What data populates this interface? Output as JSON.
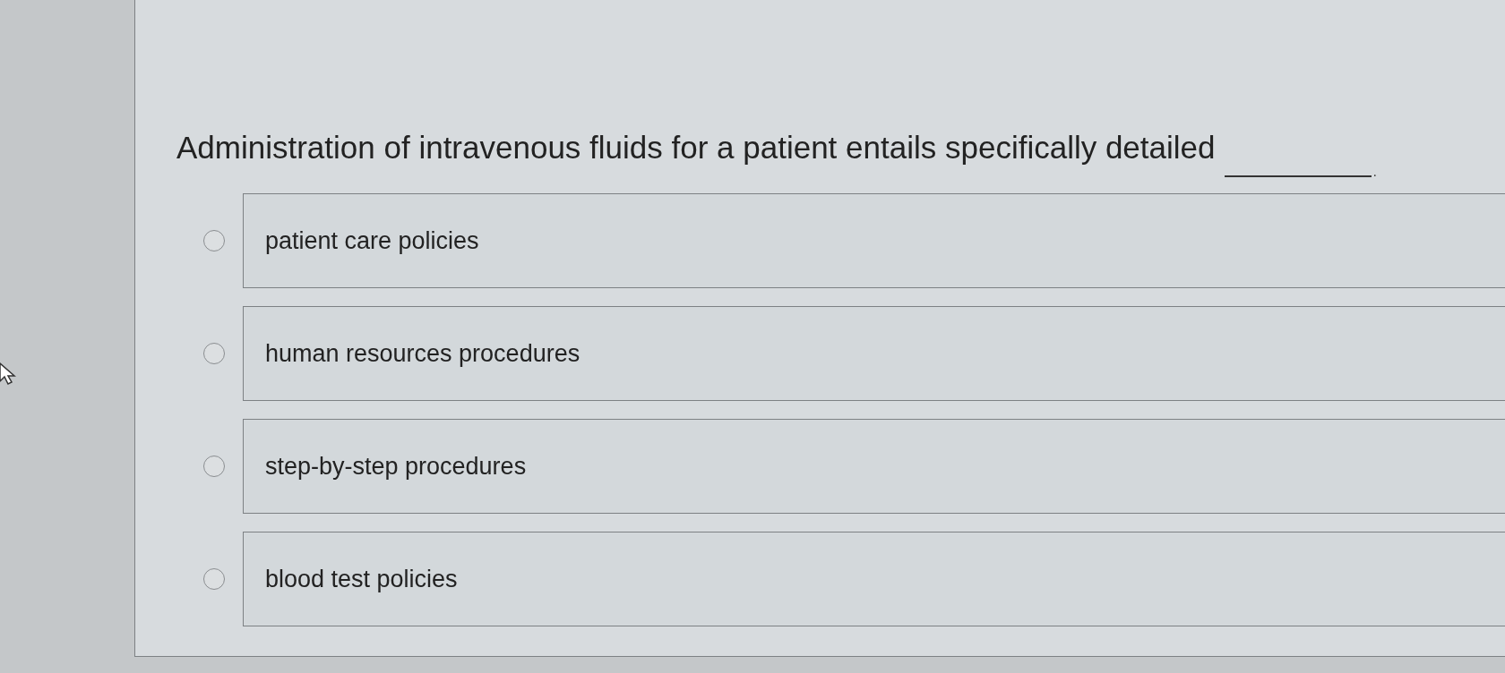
{
  "question": {
    "text": "Administration of intravenous fluids for a patient entails specifically detailed",
    "end_mark": "."
  },
  "options": [
    {
      "label": "patient care policies",
      "selected": false
    },
    {
      "label": "human resources procedures",
      "selected": false
    },
    {
      "label": "step-by-step procedures",
      "selected": false
    },
    {
      "label": "blood test policies",
      "selected": false
    }
  ]
}
